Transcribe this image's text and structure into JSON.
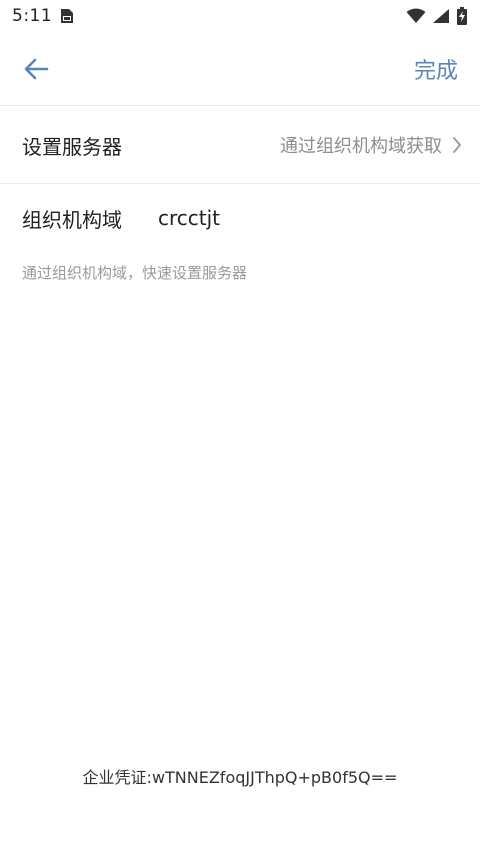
{
  "status_bar": {
    "time": "5:11",
    "icons": [
      "sim-card-icon",
      "wifi-icon",
      "cellular-signal-icon",
      "battery-charging-icon"
    ]
  },
  "app_bar": {
    "back_icon": "arrow-left-icon",
    "done_label": "完成",
    "accent_color": "#5b84b8"
  },
  "server_setting": {
    "label": "设置服务器",
    "value": "通过组织机构域获取",
    "chevron_icon": "chevron-right-icon"
  },
  "org_domain": {
    "label": "组织机构域",
    "value": "crcctjt"
  },
  "hint_text": "通过组织机构域，快速设置服务器",
  "credential_text": "企业凭证:wTNNEZfoqJJThpQ+pB0f5Q=="
}
